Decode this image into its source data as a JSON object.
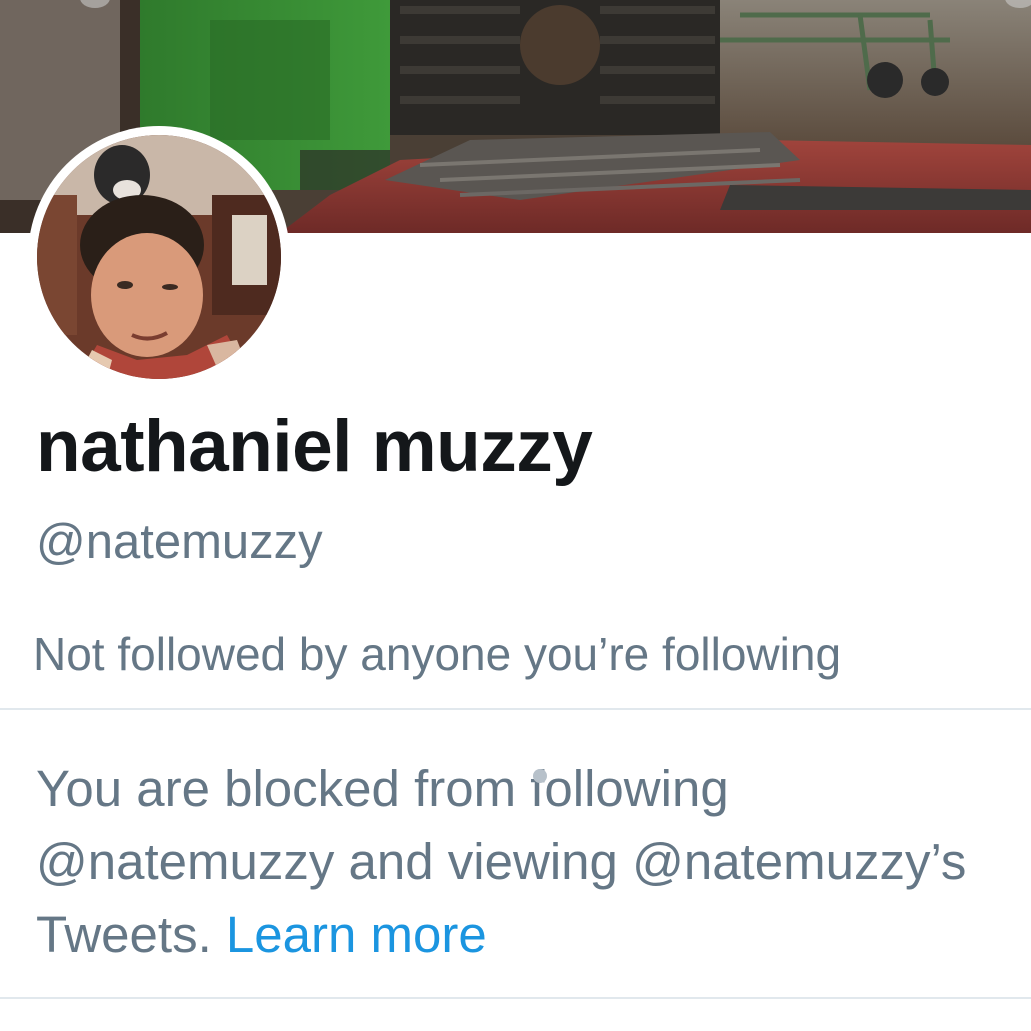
{
  "profile": {
    "display_name": "nathaniel muzzy",
    "handle": "@natemuzzy",
    "followers_note": "Not followed by anyone you’re following"
  },
  "blocked": {
    "line1": "You are blocked from following",
    "line2": "@natemuzzy and viewing @natemuzzy’s",
    "line3": "Tweets.",
    "learn_more": "Learn more"
  },
  "colors": {
    "primary_text": "#14171a",
    "secondary_text": "#657786",
    "link": "#1b95e0",
    "divider": "#e1e8ed"
  },
  "images": {
    "header": "header-photo",
    "avatar": "profile-avatar"
  }
}
